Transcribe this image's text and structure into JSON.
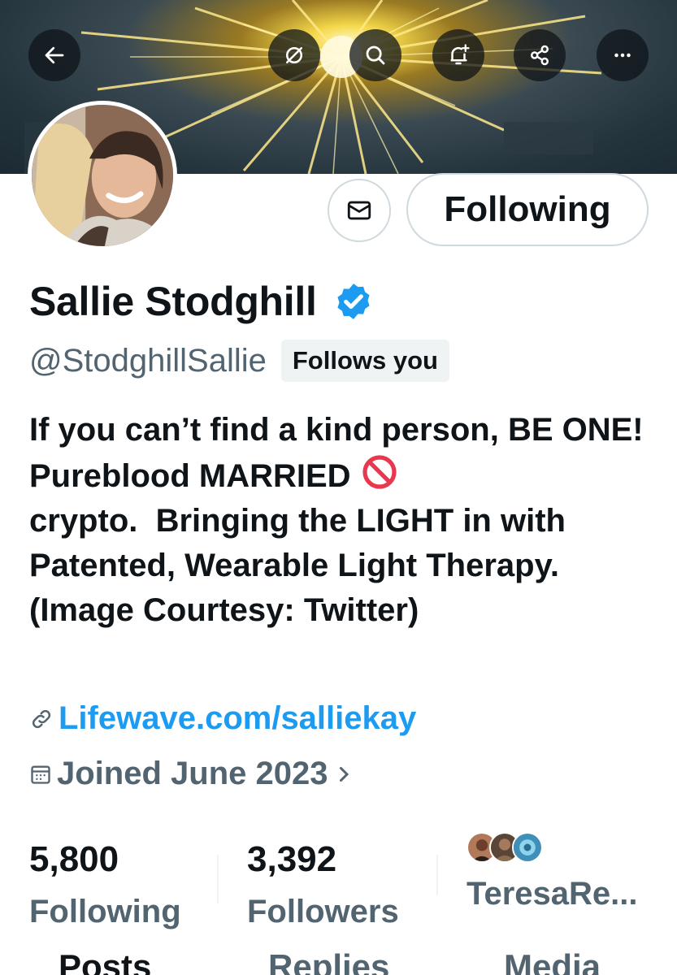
{
  "header": {
    "back_icon": "arrow-left-icon",
    "actions": [
      "grok-icon",
      "search-icon",
      "bell-plus-icon",
      "share-icon",
      "more-icon"
    ],
    "banner_colors": [
      "#1b2a33",
      "#f5d84a",
      "#fff7c0"
    ]
  },
  "profile": {
    "name": "Sallie Stodghill",
    "handle": "@StodghillSallie",
    "follows_you": "Follows you",
    "follow_button": "Following",
    "bio_line1": "If you can’t find a kind person, BE ONE! Pureblood MARRIED ",
    "bio_line2": "\ncrypto.  Bringing the LIGHT in with Patented, Wearable Light Therapy. (Image Courtesy: Twitter)",
    "bio_emoji": "prohibited-icon",
    "link": "Lifewave.com/salliekay",
    "joined": "Joined June 2023",
    "verified_color": "#1d9bf0"
  },
  "stats": {
    "following_count": "5,800",
    "following_label": "Following",
    "followers_count": "3,392",
    "followers_label": "Followers",
    "mutual_name": "TeresaRe..."
  },
  "tabs": [
    "Posts",
    "Replies",
    "Media"
  ]
}
